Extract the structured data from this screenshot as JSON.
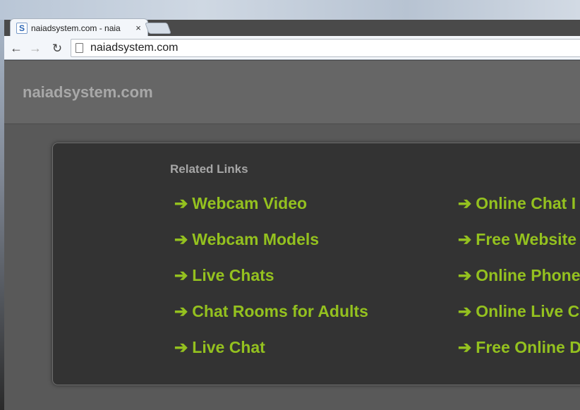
{
  "browser": {
    "tab": {
      "favicon_letter": "S",
      "title": "naiadsystem.com - naia",
      "close_glyph": "×"
    },
    "toolbar": {
      "back_glyph": "←",
      "forward_glyph": "→",
      "reload_glyph": "↻",
      "url": "naiadsystem.com"
    }
  },
  "page": {
    "site_name": "naiadsystem.com",
    "related_title": "Related Links",
    "arrow_glyph": "➔",
    "links_left": [
      "Webcam Video",
      "Webcam Models",
      "Live Chats",
      "Chat Rooms for Adults",
      "Live Chat"
    ],
    "links_right": [
      "Online Chat I",
      "Free Website",
      "Online Phone",
      "Online Live C",
      "Free Online D"
    ]
  },
  "colors": {
    "link": "#94c11f",
    "panel": "#333333",
    "header": "#666666",
    "site_name": "#a8a8a8"
  }
}
